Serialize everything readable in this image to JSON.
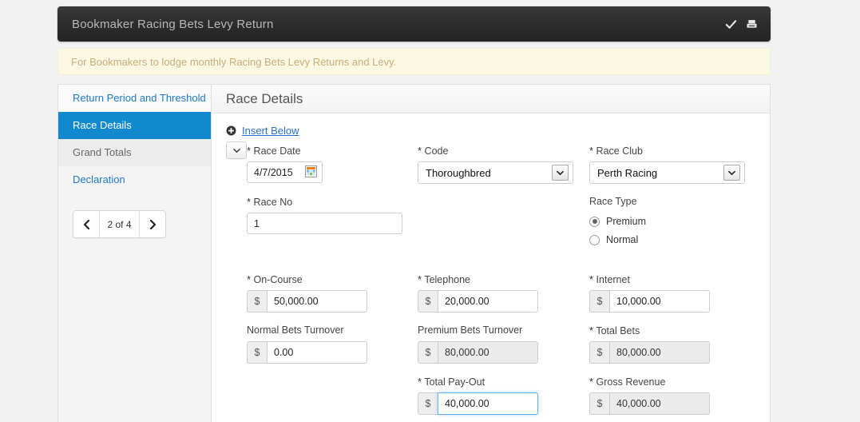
{
  "titlebar": {
    "title": "Bookmaker Racing Bets Levy Return",
    "check_icon": "check-icon",
    "save_icon": "save-disk-icon"
  },
  "banner": {
    "text": "For Bookmakers to lodge monthly Racing Bets Levy Returns and Levy."
  },
  "sidebar": {
    "items": [
      {
        "label": "Return Period and Threshold",
        "state": "link"
      },
      {
        "label": "Race Details",
        "state": "active"
      },
      {
        "label": "Grand Totals",
        "state": "muted"
      },
      {
        "label": "Declaration",
        "state": "link"
      }
    ],
    "pager": {
      "prev": "‹",
      "next": "›",
      "label": "2 of 4"
    }
  },
  "main": {
    "title": "Race Details",
    "insert_link": "Insert Below",
    "row_toggle": "▾",
    "fields": {
      "race_date": {
        "label": "Race Date",
        "required": true,
        "value": "4/7/2015"
      },
      "code": {
        "label": "Code",
        "required": true,
        "value": "Thoroughbred"
      },
      "race_club": {
        "label": "Race Club",
        "required": true,
        "value": "Perth Racing"
      },
      "race_no": {
        "label": "Race No",
        "required": true,
        "value": "1"
      },
      "race_type": {
        "label": "Race Type",
        "options": [
          {
            "label": "Premium",
            "selected": true
          },
          {
            "label": "Normal",
            "selected": false
          }
        ]
      },
      "on_course": {
        "label": "On-Course",
        "required": true,
        "prefix": "$",
        "value": "50,000.00",
        "readonly": false
      },
      "telephone": {
        "label": "Telephone",
        "required": true,
        "prefix": "$",
        "value": "20,000.00",
        "readonly": false
      },
      "internet": {
        "label": "Internet",
        "required": true,
        "prefix": "$",
        "value": "10,000.00",
        "readonly": false
      },
      "normal_bets_turnover": {
        "label": "Normal Bets Turnover",
        "required": false,
        "prefix": "$",
        "value": "0.00",
        "readonly": false
      },
      "premium_bets_turnover": {
        "label": "Premium Bets Turnover",
        "required": false,
        "prefix": "$",
        "value": "80,000.00",
        "readonly": true
      },
      "total_bets": {
        "label": "Total Bets",
        "required": true,
        "prefix": "$",
        "value": "80,000.00",
        "readonly": true
      },
      "total_payout": {
        "label": "Total Pay-Out",
        "required": true,
        "prefix": "$",
        "value": "40,000.00",
        "readonly": false,
        "focused": true
      },
      "gross_revenue": {
        "label": "Gross Revenue",
        "required": true,
        "prefix": "$",
        "value": "40,000.00",
        "readonly": true
      }
    }
  },
  "colors": {
    "accent": "#1288ce",
    "link": "#2a6fc9",
    "banner_bg": "#fcf8e3",
    "banner_text": "#c8ad7a",
    "titlebar_bg": "#2c2c2c"
  }
}
